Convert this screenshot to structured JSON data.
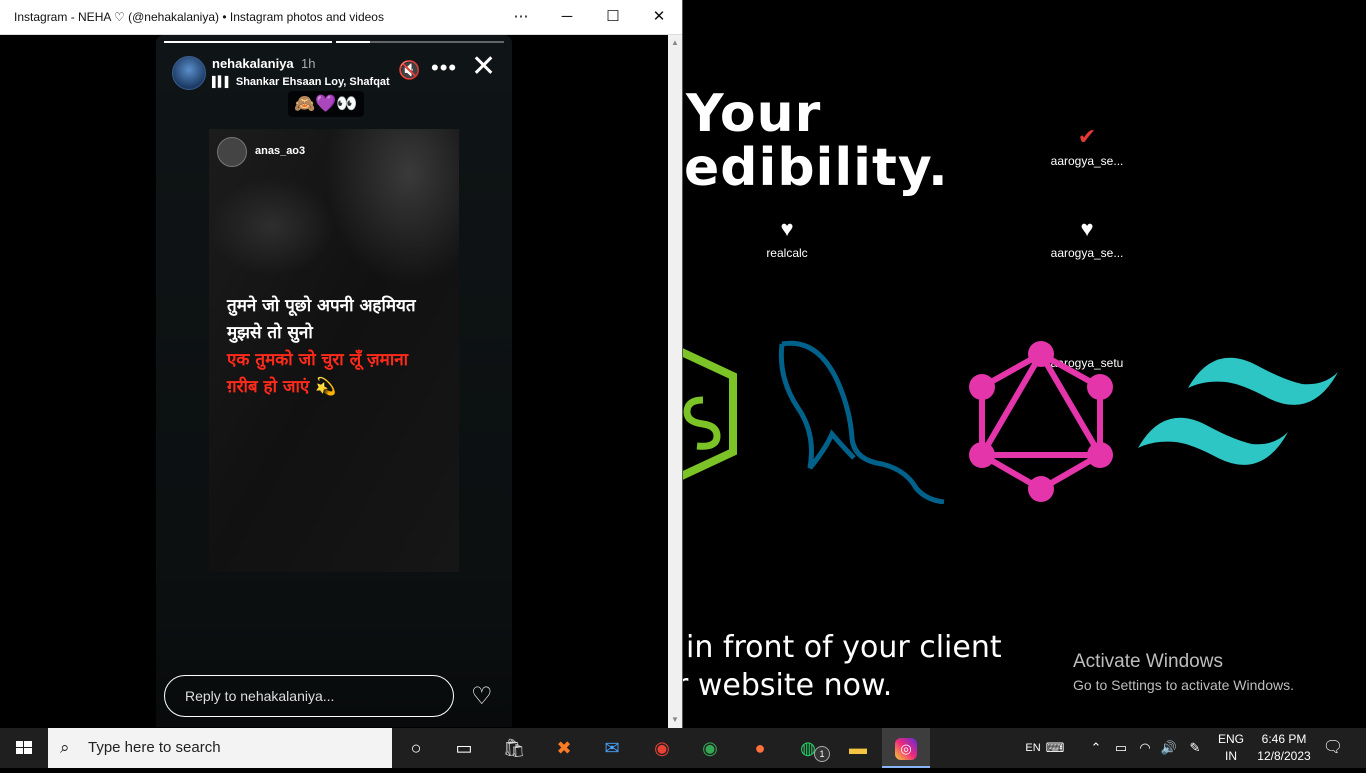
{
  "window": {
    "title": "Instagram - NEHA ♡ (@nehakalaniya) • Instagram photos and videos",
    "more_glyph": "⋯",
    "minimize_glyph": "─",
    "maximize_glyph": "☐",
    "close_glyph": "✕"
  },
  "story": {
    "progress": [
      1.0,
      0.2
    ],
    "username": "nehakalaniya",
    "time": "1h",
    "music": "Shankar Ehsaan Loy, Shafqat",
    "sticker": "🙈💜👀",
    "repost_user": "anas_ao3",
    "lines": [
      "तुमने जो पूछो अपनी अहमियत",
      "मुझसे तो सुनो",
      "एक तुमको जो चुरा लूँ ज़माना",
      "ग़रीब हो जाएं  💫"
    ],
    "colors": {
      "white_text": "#ffffff",
      "red_text": "#ff2a1a"
    },
    "reply_placeholder": "Reply to nehakalaniya...",
    "icons": {
      "mute": "🔇",
      "more": "•••",
      "close": "✕",
      "heart": "♡"
    }
  },
  "desktop": {
    "wallpaper_text_1": "Your",
    "wallpaper_text_2": "edibility.",
    "wallpaper_text_3": "in front of your client",
    "wallpaper_text_4": "r website now.",
    "icons": [
      {
        "label": "aarogya_se...",
        "icon": "check-icon"
      },
      {
        "label": "realcalc",
        "icon": "heart-check-icon"
      },
      {
        "label": "aarogya_se...",
        "icon": "heart-icon"
      },
      {
        "label": "aarogya_setu",
        "icon": "none"
      }
    ],
    "activate_title": "Activate Windows",
    "activate_sub": "Go to Settings to activate Windows.",
    "logo_colors": {
      "node": "#7cc327",
      "mysql": "#00618a",
      "graphql": "#e535ab",
      "tailwind": "#38bdf8"
    }
  },
  "taskbar": {
    "search_placeholder": "Type here to search",
    "apps": [
      "cortana",
      "task-view",
      "store",
      "xampp",
      "mail",
      "chrome",
      "chrome-profile",
      "firefox",
      "whatsapp",
      "file-explorer",
      "instagram"
    ],
    "whatsapp_badge": "1",
    "ime": "EN",
    "language_1": "ENG",
    "language_2": "IN",
    "time": "6:46 PM",
    "date": "12/8/2023"
  }
}
